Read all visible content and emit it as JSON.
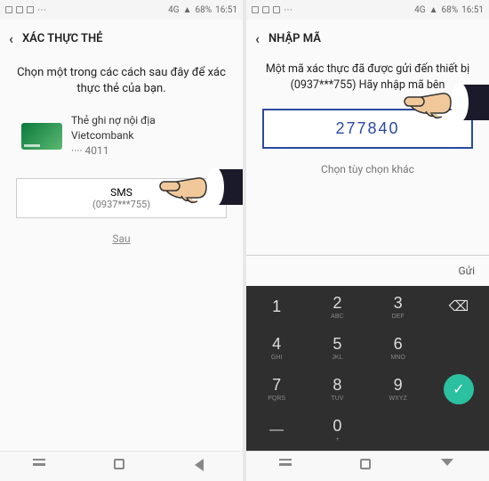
{
  "statusbar": {
    "signal_label": "4G",
    "battery": "68%",
    "time": "16:51"
  },
  "left": {
    "header_title": "XÁC THỰC THẺ",
    "instruction": "Chọn một trong các cách sau đây để xác thực thẻ của bạn.",
    "card": {
      "title": "Thẻ ghi nợ nội địa",
      "bank": "Vietcombank",
      "mask_prefix": "····",
      "last4": "4011"
    },
    "sms_label": "SMS",
    "sms_number": "(0937***755)",
    "later_label": "Sau"
  },
  "right": {
    "header_title": "NHẬP MÃ",
    "instruction": "Một mã xác thực đã được gửi đến thiết bị (0937***755) Hãy nhập mã bên",
    "code_value": "277840",
    "alt_option": "Chọn tùy chọn khác",
    "send_label": "Gửi"
  },
  "keypad": {
    "k1": "1",
    "k2": "2",
    "k2l": "ABC",
    "k3": "3",
    "k3l": "DEF",
    "k4": "4",
    "k4l": "GHI",
    "k5": "5",
    "k5l": "JKL",
    "k6": "6",
    "k6l": "MNO",
    "k7": "7",
    "k7l": "PQRS",
    "k8": "8",
    "k8l": "TUV",
    "k9": "9",
    "k9l": "WXYZ",
    "k0": "0",
    "k0l": "+",
    "backspace": "⌫",
    "dash": "—",
    "done": "✓"
  }
}
